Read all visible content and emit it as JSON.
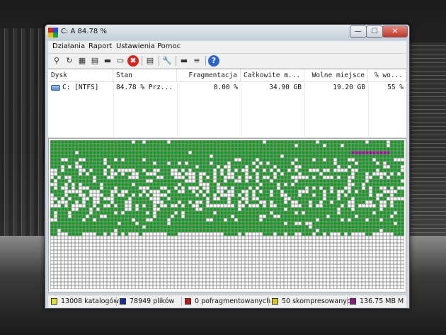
{
  "window": {
    "title": "C:  A  84.78 %",
    "controls": {
      "minimize": "—",
      "maximize": "☐",
      "close": "✕"
    }
  },
  "menu": [
    "Działania",
    "Raport",
    "Ustawienia",
    "Pomoc"
  ],
  "toolbar": [
    {
      "name": "search-icon",
      "glyph": "⚲"
    },
    {
      "name": "refresh-icon",
      "glyph": "↻"
    },
    {
      "name": "defrag-icon",
      "glyph": "▦"
    },
    {
      "name": "quick-optimize-icon",
      "glyph": "▤"
    },
    {
      "name": "full-optimize-icon",
      "glyph": "▬"
    },
    {
      "name": "pause-icon",
      "glyph": "▭"
    },
    {
      "name": "stop-icon",
      "glyph": "✖"
    },
    {
      "name": "report-icon",
      "glyph": "▤"
    },
    {
      "name": "settings-icon",
      "glyph": "🔧"
    },
    {
      "name": "console-icon",
      "glyph": "▬"
    },
    {
      "name": "script-icon",
      "glyph": "≡"
    },
    {
      "name": "help-icon",
      "glyph": "?"
    }
  ],
  "list": {
    "columns": [
      "Dysk",
      "Stan",
      "Fragmentacja",
      "Całkowite m...",
      "Wolne miejsce",
      "% wo..."
    ],
    "rows": [
      {
        "drive": "C: [NTFS]",
        "status": "84.78 % Prz...",
        "fragmentation": "0.00 %",
        "total": "34.90 GB",
        "free": "19.20 GB",
        "free_pct": "55 %"
      }
    ]
  },
  "cluster_map": {
    "colors": {
      "free": "#ffffff",
      "used": "#0f9e1d",
      "mft": "#8a1a8a",
      "grid": "#8f8f8f"
    }
  },
  "status": {
    "directories": "13008 katalogów",
    "files": "78949 plików",
    "fragmented": "0 pofragmentowanych",
    "compressed": "50 skompresowanych",
    "mft": "136.75 MB M",
    "colors": {
      "directories": "#e8df2a",
      "files": "#1a2aa8",
      "fragmented": "#c21a1a",
      "compressed": "#d8c818",
      "mft": "#8a1a8a"
    }
  }
}
